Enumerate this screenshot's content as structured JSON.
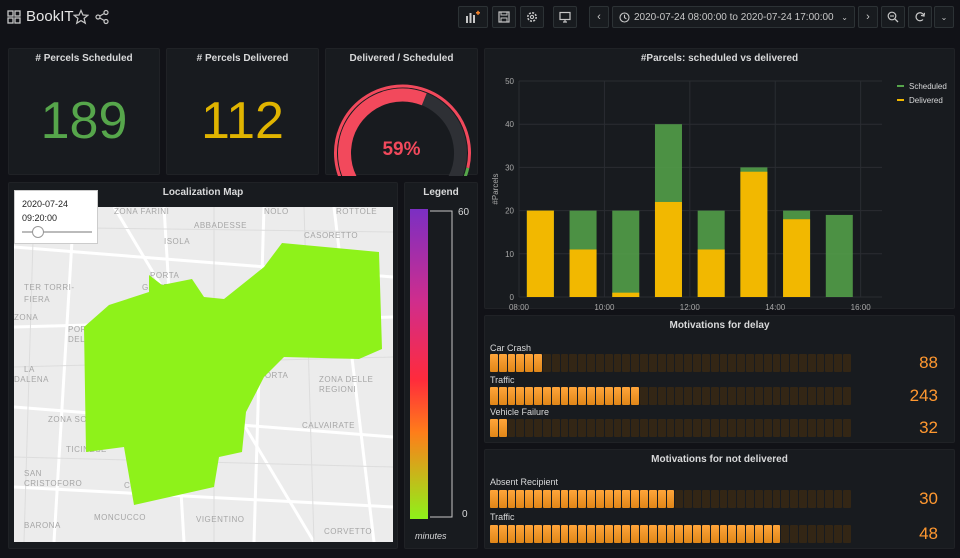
{
  "header": {
    "title": "BookIT"
  },
  "toolbar": {
    "time_range": "2020-07-24 08:00:00 to 2020-07-24 17:00:00"
  },
  "stats": {
    "scheduled": {
      "title": "# Percels Scheduled",
      "value": "189",
      "color": "#56a64b"
    },
    "delivered": {
      "title": "# Percels Delivered",
      "value": "112",
      "color": "#e0b400"
    },
    "ratio": {
      "title": "Delivered / Scheduled",
      "value": "59%",
      "fraction": 0.59,
      "color": "#f2495c"
    }
  },
  "map": {
    "title": "Localization Map",
    "slider_date": "2020-07-24",
    "slider_time": "09:20:00",
    "slider_fraction": 0.22,
    "region_color": "#8ef21a",
    "labels": [
      "ZONA FARINI",
      "NOLO",
      "ROTTOLE",
      "ABBADESSE",
      "ISOLA",
      "CASORETTO",
      "PORTA",
      "GARIBALDI",
      "TER TORRI-",
      "FIERA",
      "ZONA",
      "PORTELLO",
      "DELLA",
      "LA",
      "DALENA",
      "PORTA",
      "ZONA DELLE",
      "REGIONI",
      "ZONA SOLARI",
      "CALVAIRATE",
      "TICINESE",
      "SAN",
      "CRISTOFORO",
      "CORSO",
      "BARONA",
      "MONCUCCO",
      "VIGENTINO",
      "CORVETTO"
    ]
  },
  "legend": {
    "title": "Legend",
    "max": "60",
    "min": "0",
    "unit": "minutes"
  },
  "chart_data": {
    "type": "bar",
    "title": "#Parcels: scheduled vs delivered",
    "ylabel": "#Parcels",
    "xlabel": "",
    "x_tick_labels": [
      "08:00",
      "10:00",
      "12:00",
      "14:00",
      "16:00"
    ],
    "categories": [
      "08:30",
      "09:30",
      "10:30",
      "11:30",
      "12:30",
      "13:30",
      "14:30",
      "15:30"
    ],
    "ylim": [
      0,
      50
    ],
    "y_ticks": [
      0,
      10,
      20,
      30,
      40,
      50
    ],
    "grid": true,
    "legend_position": "top-right",
    "series": [
      {
        "name": "Scheduled",
        "color": "#56a64b",
        "values": [
          20,
          20,
          20,
          40,
          20,
          30,
          20,
          19
        ]
      },
      {
        "name": "Delivered",
        "color": "#f2b800",
        "values": [
          20,
          11,
          1,
          22,
          11,
          29,
          18,
          0
        ]
      }
    ]
  },
  "delay": {
    "title": "Motivations for delay",
    "max": 600,
    "rows": [
      {
        "label": "Car Crash",
        "value": "88",
        "num": 88
      },
      {
        "label": "Traffic",
        "value": "243",
        "num": 243
      },
      {
        "label": "Vehicle Failure",
        "value": "32",
        "num": 32
      }
    ]
  },
  "not_delivered": {
    "title": "Motivations for not delivered",
    "max": 60,
    "rows": [
      {
        "label": "Absent Recipient",
        "value": "30",
        "num": 30
      },
      {
        "label": "Traffic",
        "value": "48",
        "num": 48
      }
    ]
  }
}
